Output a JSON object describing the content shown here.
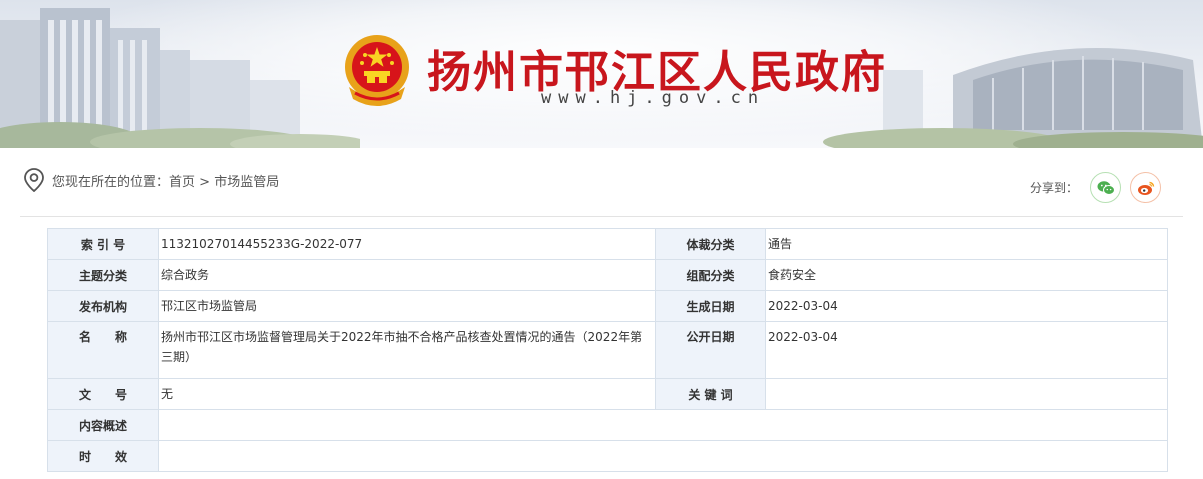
{
  "header": {
    "title": "扬州市邗江区人民政府",
    "url": "www.hj.gov.cn"
  },
  "breadcrumb": {
    "prefix": "您现在所在的位置：",
    "home": "首页",
    "separator": ">",
    "current": "市场监管局"
  },
  "share": {
    "label": "分享到："
  },
  "info": {
    "index_label": "索 引 号",
    "index_value": "11321027014455233G-2022-077",
    "genre_label": "体裁分类",
    "genre_value": "通告",
    "topic_label": "主题分类",
    "topic_value": "综合政务",
    "group_label": "组配分类",
    "group_value": "食药安全",
    "publisher_label": "发布机构",
    "publisher_value": "邗江区市场监管局",
    "created_label": "生成日期",
    "created_value": "2022-03-04",
    "name_label": "名　　称",
    "name_value": "扬州市邗江区市场监督管理局关于2022年市抽不合格产品核查处置情况的通告（2022年第三期）",
    "published_label": "公开日期",
    "published_value": "2022-03-04",
    "docno_label": "文　　号",
    "docno_value": "无",
    "keywords_label": "关 键 词",
    "keywords_value": "",
    "summary_label": "内容概述",
    "summary_value": "",
    "validity_label": "时　　效",
    "validity_value": ""
  },
  "colors": {
    "title_red": "#c8161d",
    "key_cell_bg": "#eef3fa",
    "table_border": "#d7e0ea",
    "wechat_green": "#4caf50",
    "weibo_orange": "#e8541e"
  }
}
